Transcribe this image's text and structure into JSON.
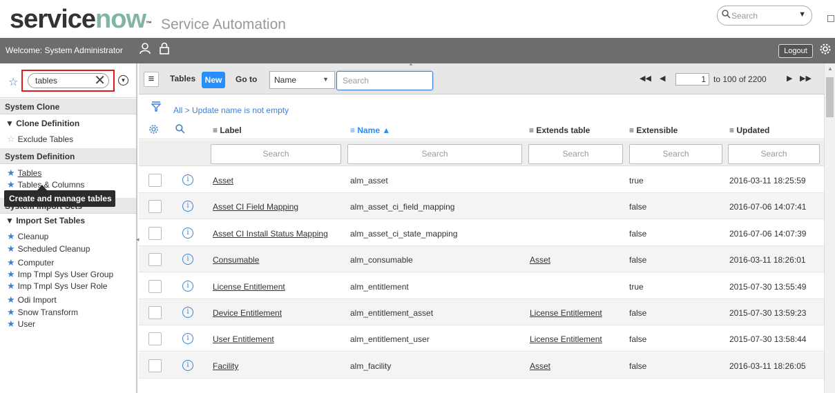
{
  "banner": {
    "logo_service": "service",
    "logo_now": "now",
    "logo_tm": "™",
    "app_title": "Service Automation",
    "search_placeholder": "Search",
    "search_icon": "search-icon",
    "dropdown_glyph": "▼"
  },
  "welcome": {
    "text": "Welcome:  System Administrator",
    "logout_label": "Logout",
    "icons": [
      "user-icon",
      "lock-icon",
      "gear-icon"
    ]
  },
  "nav": {
    "filter_value": "tables",
    "sections": {
      "system_clone": "System Clone",
      "clone_definition": "▼ Clone Definition",
      "exclude_tables": "Exclude Tables",
      "system_definition": "System Definition",
      "tables": "Tables",
      "tables_columns": "Tables & Columns",
      "system_import_sets": "System Import Sets",
      "import_set_tables": "▼ Import Set Tables"
    },
    "import_items": [
      "Cleanup",
      "Scheduled Cleanup",
      "Computer",
      "Imp Tmpl Sys User Group",
      "Imp Tmpl Sys User Role",
      "Odi Import",
      "Snow Transform",
      "User"
    ],
    "tooltip": "Create and manage tables",
    "accent_color": "#3c81d6"
  },
  "list": {
    "title": "Tables",
    "new_label": "New",
    "goto_label": "Go to",
    "goto_field": "Name",
    "search_placeholder": "Search",
    "page_value": "1",
    "page_range": "to 100 of 2200",
    "breadcrumb": "All > Update name is not empty",
    "columns": {
      "label": "≡ Label",
      "name": "≡ Name ▲",
      "extends": "≡ Extends table",
      "extensible": "≡ Extensible",
      "updated": "≡ Updated"
    },
    "column_search_placeholder": "Search",
    "rows": [
      {
        "label": "Asset",
        "name": "alm_asset",
        "extends": "",
        "extensible": "true",
        "updated": "2016-03-11 18:25:59"
      },
      {
        "label": "Asset CI Field Mapping",
        "name": "alm_asset_ci_field_mapping",
        "extends": "",
        "extensible": "false",
        "updated": "2016-07-06 14:07:41"
      },
      {
        "label": "Asset CI Install Status Mapping",
        "name": "alm_asset_ci_state_mapping",
        "extends": "",
        "extensible": "false",
        "updated": "2016-07-06 14:07:39"
      },
      {
        "label": "Consumable",
        "name": "alm_consumable",
        "extends": "Asset",
        "extensible": "false",
        "updated": "2016-03-11 18:26:01"
      },
      {
        "label": "License Entitlement",
        "name": "alm_entitlement",
        "extends": "",
        "extensible": "true",
        "updated": "2015-07-30 13:55:49"
      },
      {
        "label": "Device Entitlement",
        "name": "alm_entitlement_asset",
        "extends": "License Entitlement",
        "extensible": "false",
        "updated": "2015-07-30 13:59:23"
      },
      {
        "label": "User Entitlement",
        "name": "alm_entitlement_user",
        "extends": "License Entitlement",
        "extensible": "false",
        "updated": "2015-07-30 13:58:44"
      },
      {
        "label": "Facility",
        "name": "alm_facility",
        "extends": "Asset",
        "extensible": "false",
        "updated": "2016-03-11 18:26:05"
      }
    ],
    "brand_blue": "#278efc"
  }
}
